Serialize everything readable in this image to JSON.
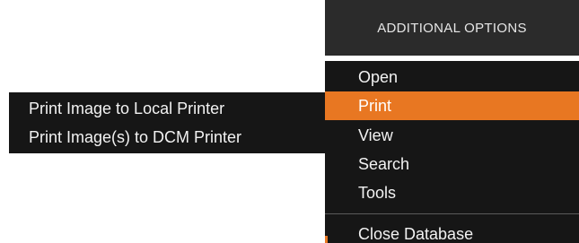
{
  "header": {
    "title": "ADDITIONAL OPTIONS"
  },
  "menu": {
    "items": [
      {
        "label": "Open",
        "active": false
      },
      {
        "label": "Print",
        "active": true
      },
      {
        "label": "View",
        "active": false
      },
      {
        "label": "Search",
        "active": false
      },
      {
        "label": "Tools",
        "active": false
      },
      {
        "label": "Close Database",
        "active": false
      }
    ]
  },
  "submenu": {
    "items": [
      {
        "label": "Print Image to Local Printer"
      },
      {
        "label": "Print Image(s) to DCM Printer"
      }
    ]
  },
  "colors": {
    "menu_bg": "#161616",
    "header_bg": "#2b2b2b",
    "accent": "#e87722",
    "text": "#f2f2f2"
  }
}
